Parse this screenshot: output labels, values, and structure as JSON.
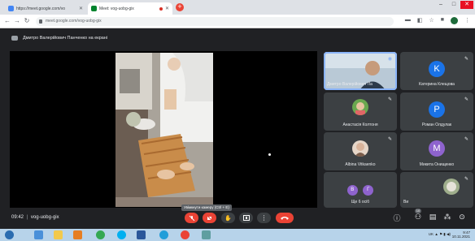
{
  "browser": {
    "tabs": [
      {
        "title": "https://meet.google.com/vo",
        "favicon_color": "#4285f4",
        "active": false
      },
      {
        "title": "Meet: vog-uobg-gix",
        "favicon_color": "#00832d",
        "active": true
      }
    ],
    "url": "meet.google.com/vog-uobg-gix"
  },
  "meeting": {
    "presenter_banner": "Дмитро Валерійович Панченко на екрані",
    "code": "vog-uobg-gix",
    "time": "09:42",
    "camera_tooltip": "Увімкнути камеру (Ctrl + E)",
    "participant_badge": "10"
  },
  "participants": [
    {
      "name": "Дмитро Валерійович Па",
      "type": "photo",
      "active": true
    },
    {
      "name": "Катерина Клещова",
      "type": "letter",
      "letter": "K",
      "color": "#1a73e8"
    },
    {
      "name": "Анастасія Колтоня",
      "type": "photo"
    },
    {
      "name": "Роман Олдулак",
      "type": "letter",
      "letter": "P",
      "color": "#1a73e8"
    },
    {
      "name": "Albina Vitkaenko",
      "type": "photo"
    },
    {
      "name": "Микита Онищенко",
      "type": "letter",
      "letter": "M",
      "color": "#8e63ce"
    },
    {
      "name": "Ще 6 осіб",
      "type": "group",
      "letters": [
        "B",
        "Г"
      ],
      "colors": [
        "#8e63ce",
        "#8e63ce"
      ]
    },
    {
      "name": "Ви",
      "type": "photo"
    }
  ],
  "colors": {
    "meet_bg": "#202124",
    "tile_bg": "#3c4043",
    "end_call": "#ea4335",
    "taskbar": "#b7d3ea"
  },
  "icons": {
    "controls": [
      "mic-off-icon",
      "camera-off-icon",
      "raise-hand-icon",
      "present-icon",
      "more-icon",
      "end-call-icon"
    ],
    "right": [
      "info-icon",
      "people-icon",
      "chat-icon",
      "activities-icon",
      "lock-icon"
    ]
  },
  "taskbar": {
    "lang": "UK",
    "time": "9:47",
    "date": "10.11.2021"
  }
}
